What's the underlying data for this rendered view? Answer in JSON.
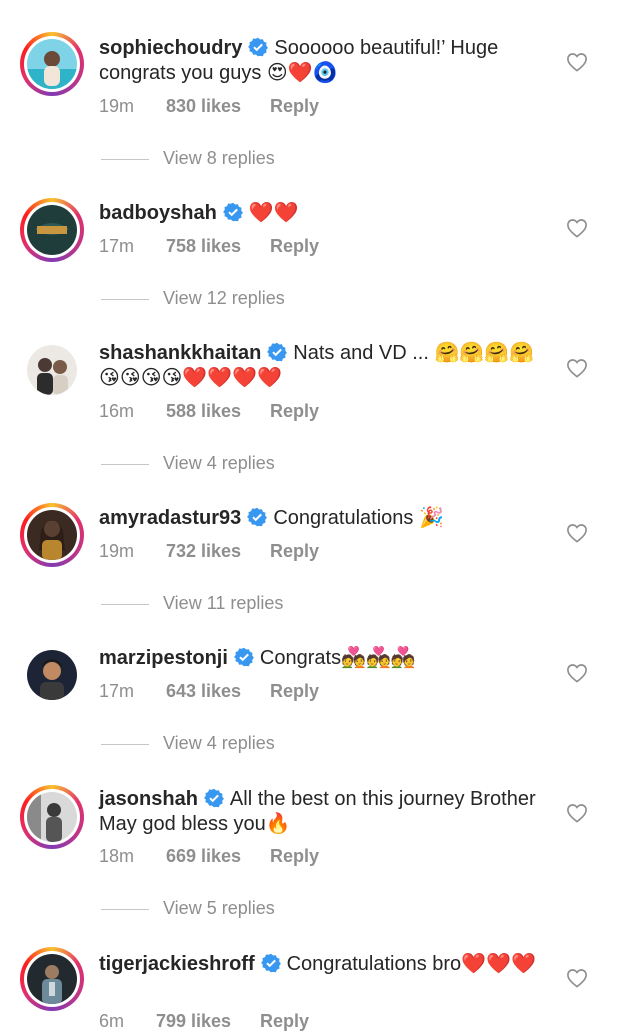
{
  "comments": [
    {
      "username": "sophiechoudry",
      "text": "Soooooo beautiful!’ Huge congrats you guys 😍❤️🧿",
      "time": "19m",
      "likes": "830 likes",
      "reply": "Reply",
      "view_replies": "View 8 replies"
    },
    {
      "username": "badboyshah",
      "text": "❤️❤️",
      "time": "17m",
      "likes": "758 likes",
      "reply": "Reply",
      "view_replies": "View 12 replies"
    },
    {
      "username": "shashankkhaitan",
      "text": "Nats and VD ... 🤗🤗🤗🤗😘😘😘😘❤️❤️❤️❤️",
      "time": "16m",
      "likes": "588 likes",
      "reply": "Reply",
      "view_replies": "View 4 replies"
    },
    {
      "username": "amyradastur93",
      "text": "Congratulations 🎉",
      "time": "19m",
      "likes": "732 likes",
      "reply": "Reply",
      "view_replies": "View 11 replies"
    },
    {
      "username": "marzipestonji",
      "text": "Congrats💑💑💑",
      "time": "17m",
      "likes": "643 likes",
      "reply": "Reply",
      "view_replies": "View 4 replies"
    },
    {
      "username": "jasonshah",
      "text": "All the best on this journey Brother May god bless you🔥",
      "time": "18m",
      "likes": "669 likes",
      "reply": "Reply",
      "view_replies": "View 5 replies"
    },
    {
      "username": "tigerjackieshroff",
      "text": "Congratulations bro❤️❤️❤️",
      "time": "6m",
      "likes": "799 likes",
      "reply": "Reply",
      "view_replies": ""
    }
  ],
  "icons": {
    "verified": "verified-badge-icon",
    "like": "heart-outline-icon"
  },
  "colors": {
    "verified_blue": "#3897f0",
    "meta_gray": "#8e8e8e",
    "text": "#262626"
  }
}
